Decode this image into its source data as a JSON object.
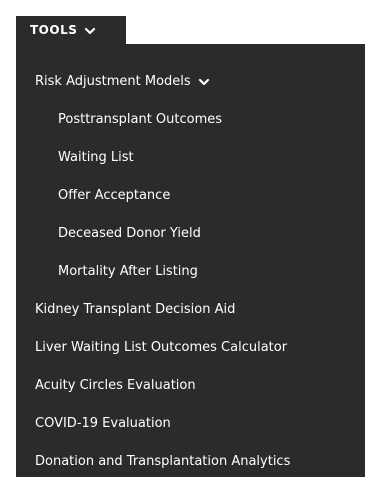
{
  "tab": {
    "label": "TOOLS",
    "icon": "chevron-down-icon"
  },
  "menu": {
    "group": {
      "label": "Risk Adjustment Models",
      "icon": "chevron-down-icon",
      "children": [
        "Posttransplant Outcomes",
        "Waiting List",
        "Offer Acceptance",
        "Deceased Donor Yield",
        "Mortality After Listing"
      ]
    },
    "items": [
      "Kidney Transplant Decision Aid",
      "Liver Waiting List Outcomes Calculator",
      "Acuity Circles Evaluation",
      "COVID-19 Evaluation",
      "Donation and Transplantation Analytics"
    ]
  },
  "colors": {
    "menu_background": "#2b2b2b",
    "text": "#ffffff",
    "page_background": "#ffffff"
  }
}
